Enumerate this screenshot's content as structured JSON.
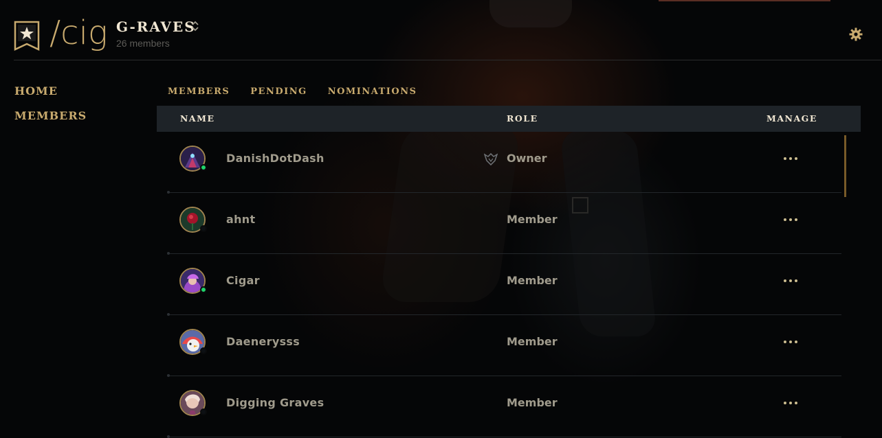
{
  "header": {
    "tag": "/cig",
    "club_name": "G-RAVES",
    "member_count": "26 members",
    "icons": {
      "banner": "club-banner-star-icon",
      "switch": "chevron-up-down-icon",
      "settings": "gear-icon"
    }
  },
  "nav": {
    "items": [
      {
        "label": "HOME"
      },
      {
        "label": "MEMBERS"
      }
    ]
  },
  "tabs": [
    {
      "label": "MEMBERS"
    },
    {
      "label": "PENDING"
    },
    {
      "label": "NOMINATIONS"
    }
  ],
  "table": {
    "columns": {
      "name": "NAME",
      "role": "ROLE",
      "manage": "MANAGE"
    },
    "rows": [
      {
        "name": "DanishDotDash",
        "role": "Owner",
        "status": "online",
        "role_icon": "owner-crest-icon",
        "avatar_color": "#3a2a5a"
      },
      {
        "name": "ahnt",
        "role": "Member",
        "status": "offline",
        "avatar_color": "#5a1a1e"
      },
      {
        "name": "Cigar",
        "role": "Member",
        "status": "online",
        "avatar_color": "#6a3a8a"
      },
      {
        "name": "Daenerysss",
        "role": "Member",
        "status": "offline",
        "avatar_color": "#7a6a8a"
      },
      {
        "name": "Digging Graves",
        "role": "Member",
        "status": "offline",
        "avatar_color": "#8a6a6a"
      }
    ]
  },
  "colors": {
    "gold": "#c8aa6e",
    "light_gold": "#f0e6d2",
    "text_gray": "#a09b8c",
    "online": "#1fd36b",
    "header_bg": "#1e2328"
  }
}
